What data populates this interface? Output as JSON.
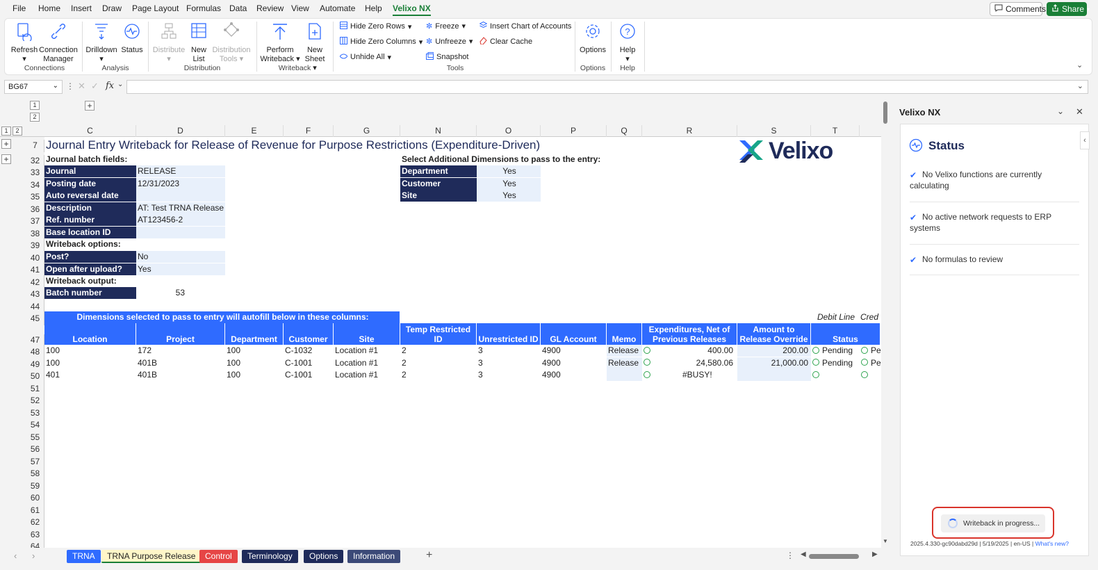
{
  "menu": [
    "File",
    "Home",
    "Insert",
    "Draw",
    "Page Layout",
    "Formulas",
    "Data",
    "Review",
    "View",
    "Automate",
    "Help",
    "Velixo NX"
  ],
  "top_buttons": {
    "comments": "Comments",
    "share": "Share"
  },
  "ribbon": {
    "refresh": "Refresh",
    "connection_manager_1": "Connection",
    "connection_manager_2": "Manager",
    "drilldown": "Drilldown",
    "status": "Status",
    "distribute": "Distribute",
    "new_list_1": "New",
    "new_list_2": "List",
    "distribution_tools_1": "Distribution",
    "distribution_tools_2": "Tools",
    "perform_writeback_1": "Perform",
    "perform_writeback_2": "Writeback",
    "new_sheet_1": "New",
    "new_sheet_2": "Sheet",
    "hide_zero_rows": "Hide Zero Rows",
    "hide_zero_columns": "Hide Zero Columns",
    "unhide_all": "Unhide All",
    "freeze": "Freeze",
    "unfreeze": "Unfreeze",
    "snapshot": "Snapshot",
    "insert_coa": "Insert Chart of Accounts",
    "clear_cache": "Clear Cache",
    "options": "Options",
    "help": "Help",
    "groups": {
      "connections": "Connections",
      "analysis": "Analysis",
      "distribution": "Distribution",
      "writeback": "Writeback",
      "tools": "Tools",
      "options": "Options",
      "help": "Help"
    }
  },
  "formula_bar": {
    "name_box": "BG67",
    "fx": "fx"
  },
  "outline_levels": [
    "1",
    "2"
  ],
  "columns": [
    "C",
    "D",
    "E",
    "F",
    "G",
    "N",
    "O",
    "P",
    "Q",
    "R",
    "S",
    "T"
  ],
  "row_numbers": [
    "7",
    "32",
    "33",
    "34",
    "35",
    "36",
    "37",
    "38",
    "39",
    "40",
    "41",
    "42",
    "43",
    "44",
    "45",
    "47",
    "48",
    "49",
    "50",
    "51",
    "52",
    "53",
    "54",
    "55",
    "56",
    "57",
    "58",
    "59",
    "60",
    "61",
    "62",
    "63",
    "64"
  ],
  "sheet": {
    "title": "Journal Entry Writeback for Release of Revenue for Purpose Restrictions (Expenditure-Driven)",
    "logo_text": "Velixo",
    "batch_fields_label": "Journal batch fields:",
    "fields": [
      {
        "label": "Journal",
        "value": "RELEASE"
      },
      {
        "label": "Posting date",
        "value": "12/31/2023"
      },
      {
        "label": "Auto reversal date",
        "value": ""
      },
      {
        "label": "Description",
        "value": "AT: Test TRNA Release"
      },
      {
        "label": "Ref. number",
        "value": "AT123456-2"
      },
      {
        "label": "Base location ID",
        "value": ""
      }
    ],
    "writeback_options_label": "Writeback options:",
    "options": [
      {
        "label": "Post?",
        "value": "No"
      },
      {
        "label": "Open after upload?",
        "value": "Yes"
      }
    ],
    "writeback_output_label": "Writeback output:",
    "batch_number_label": "Batch number",
    "batch_number_value": "53",
    "dims_label": "Select Additional Dimensions to pass to the entry:",
    "dims": [
      {
        "label": "Department",
        "value": "Yes"
      },
      {
        "label": "Customer",
        "value": "Yes"
      },
      {
        "label": "Site",
        "value": "Yes"
      }
    ],
    "dims_banner": "Dimensions selected to pass to entry will autofill below in these columns:",
    "debit_line": "Debit Line",
    "credit_line": "Cred",
    "table_headers": [
      "Location",
      "Project",
      "Department",
      "Customer",
      "Site",
      "Temp Restricted ID",
      "Unrestricted ID",
      "GL Account",
      "Memo",
      "Expenditures, Net of Previous Releases",
      "Amount to Release Override",
      "Status"
    ],
    "table_rows": [
      {
        "location": "100",
        "project": "172",
        "department": "100",
        "customer": "C-1032",
        "site": "Location #1",
        "temp": "2",
        "unres": "3",
        "gl": "4900",
        "memo": "Release",
        "exp": "400.00",
        "override": "200.00",
        "status1": "Pending",
        "status2": "Pe"
      },
      {
        "location": "100",
        "project": "401B",
        "department": "100",
        "customer": "C-1001",
        "site": "Location #1",
        "temp": "2",
        "unres": "3",
        "gl": "4900",
        "memo": "Release",
        "exp": "24,580.06",
        "override": "21,000.00",
        "status1": "Pending",
        "status2": "Pe"
      },
      {
        "location": "401",
        "project": "401B",
        "department": "100",
        "customer": "C-1001",
        "site": "Location #1",
        "temp": "2",
        "unres": "3",
        "gl": "4900",
        "memo": "",
        "exp": "#BUSY!",
        "override": "",
        "status1": "",
        "status2": ""
      }
    ]
  },
  "tabs": [
    {
      "label": "TRNA",
      "bg": "#2f6bff",
      "fg": "#ffffff"
    },
    {
      "label": "TRNA Purpose Release",
      "bg": "#fff6c8",
      "fg": "#222222"
    },
    {
      "label": "Control",
      "bg": "#e64545",
      "fg": "#ffffff"
    },
    {
      "label": "Terminology",
      "bg": "#1f2b5a",
      "fg": "#ffffff"
    },
    {
      "label": "Options",
      "bg": "#1f2b5a",
      "fg": "#ffffff"
    },
    {
      "label": "Information",
      "bg": "#3c4a78",
      "fg": "#ffffff"
    }
  ],
  "pane": {
    "title": "Velixo NX",
    "status_heading": "Status",
    "items": [
      "No Velixo functions are currently calculating",
      "No active network requests to ERP systems",
      "No formulas to review"
    ],
    "progress_text": "Writeback in progress...",
    "version_text": "2025.4.330-gc90dabd29d | 5/19/2025 | en-US |",
    "whats_new": "What's new?"
  },
  "colors": {
    "accent": "#1a7f37",
    "label_navy": "#1f2b5a",
    "header_blue": "#2f6bff",
    "highlight_red": "#d9342b"
  }
}
